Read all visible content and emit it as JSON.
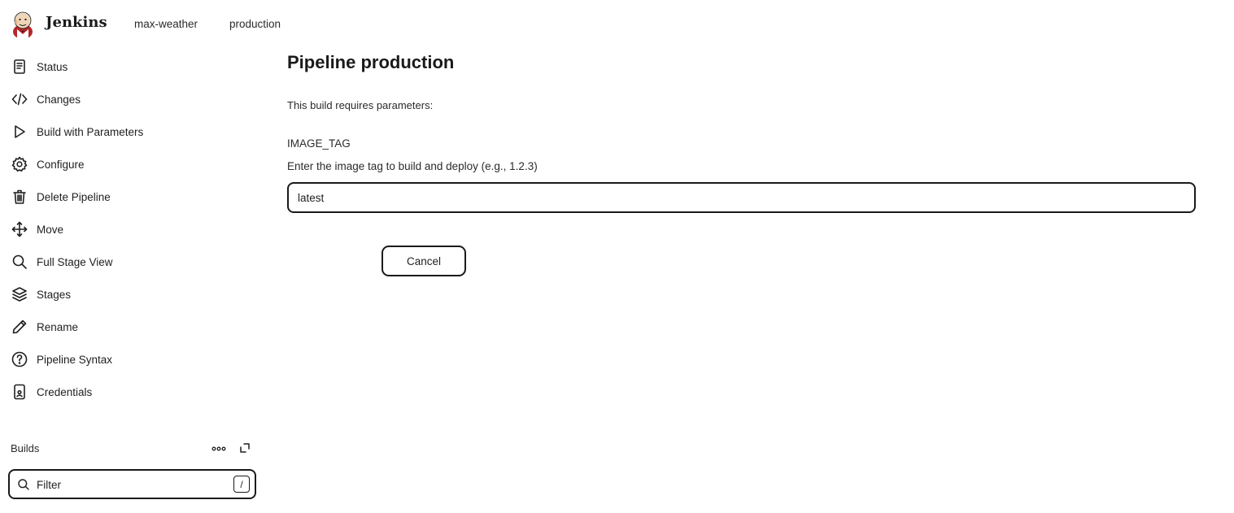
{
  "header": {
    "brand": "Jenkins",
    "logo_icon": "jenkins-butler-logo",
    "breadcrumbs": [
      "max-weather",
      "production"
    ]
  },
  "sidebar": {
    "items": [
      {
        "label": "Status",
        "icon": "document-icon"
      },
      {
        "label": "Changes",
        "icon": "code-icon"
      },
      {
        "label": "Build with Parameters",
        "icon": "play-icon"
      },
      {
        "label": "Configure",
        "icon": "gear-icon"
      },
      {
        "label": "Delete Pipeline",
        "icon": "trash-icon"
      },
      {
        "label": "Move",
        "icon": "move-icon"
      },
      {
        "label": "Full Stage View",
        "icon": "search-icon"
      },
      {
        "label": "Stages",
        "icon": "layers-icon"
      },
      {
        "label": "Rename",
        "icon": "pencil-icon"
      },
      {
        "label": "Pipeline Syntax",
        "icon": "help-circle-icon"
      },
      {
        "label": "Credentials",
        "icon": "credentials-icon"
      }
    ],
    "builds": {
      "title": "Builds",
      "filter_placeholder": "Filter",
      "filter_shortcut": "/"
    }
  },
  "main": {
    "title": "Pipeline production",
    "requires_text": "This build requires parameters:",
    "param": {
      "name": "IMAGE_TAG",
      "description": "Enter the image tag to build and deploy (e.g., 1.2.3)",
      "value": "latest"
    },
    "cancel_label": "Cancel"
  }
}
